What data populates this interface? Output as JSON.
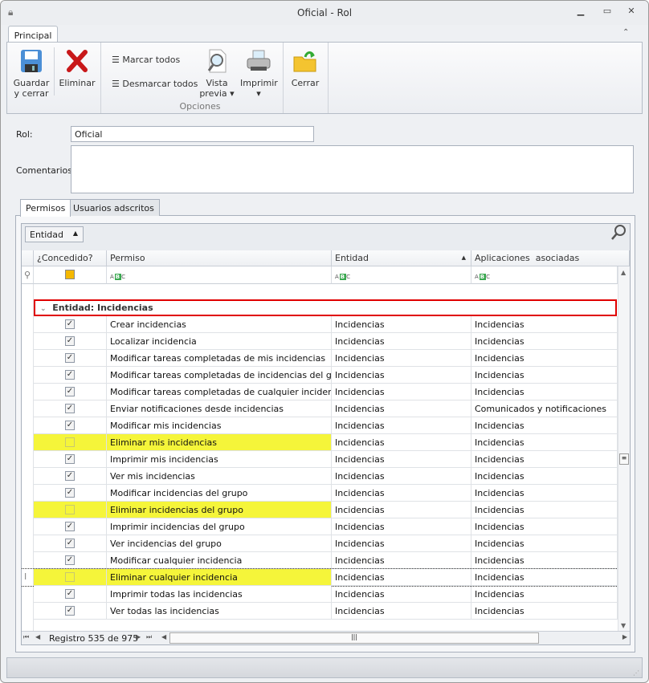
{
  "window": {
    "title": "Oficial - Rol"
  },
  "ribbon": {
    "tab": "Principal",
    "buttons": {
      "save": "Guardar\ny cerrar",
      "delete": "Eliminar",
      "check_all": "Marcar todos",
      "uncheck_all": "Desmarcar todos",
      "preview": "Vista\nprevia",
      "print": "Imprimir",
      "close": "Cerrar"
    },
    "group_label": "Opciones"
  },
  "form": {
    "rol_label": "Rol:",
    "rol_value": "Oficial",
    "comments_label": "Comentarios:",
    "comments_value": ""
  },
  "tabs": [
    "Permisos",
    "Usuarios adscritos"
  ],
  "grid": {
    "group_by_chip": "Entidad",
    "columns": [
      "¿Concedido?",
      "Permiso",
      "Entidad",
      "Aplicaciones  asociadas"
    ],
    "group_row": "Entidad: Incidencias",
    "highlight_color": "#f5f53a",
    "rows": [
      {
        "granted": true,
        "permiso": "Crear incidencias",
        "entidad": "Incidencias",
        "apps": "Incidencias"
      },
      {
        "granted": true,
        "permiso": "Localizar incidencia",
        "entidad": "Incidencias",
        "apps": "Incidencias"
      },
      {
        "granted": true,
        "permiso": "Modificar tareas completadas de mis incidencias",
        "entidad": "Incidencias",
        "apps": "Incidencias"
      },
      {
        "granted": true,
        "permiso": "Modificar tareas completadas de incidencias del grupo",
        "entidad": "Incidencias",
        "apps": "Incidencias"
      },
      {
        "granted": true,
        "permiso": "Modificar tareas completadas de cualquier incidencia",
        "entidad": "Incidencias",
        "apps": "Incidencias"
      },
      {
        "granted": true,
        "permiso": "Enviar notificaciones desde incidencias",
        "entidad": "Incidencias",
        "apps": "Comunicados y notificaciones"
      },
      {
        "granted": true,
        "permiso": "Modificar mis incidencias",
        "entidad": "Incidencias",
        "apps": "Incidencias"
      },
      {
        "granted": false,
        "permiso": "Eliminar mis incidencias",
        "entidad": "Incidencias",
        "apps": "Incidencias"
      },
      {
        "granted": true,
        "permiso": "Imprimir mis incidencias",
        "entidad": "Incidencias",
        "apps": "Incidencias"
      },
      {
        "granted": true,
        "permiso": "Ver mis incidencias",
        "entidad": "Incidencias",
        "apps": "Incidencias"
      },
      {
        "granted": true,
        "permiso": "Modificar incidencias del grupo",
        "entidad": "Incidencias",
        "apps": "Incidencias"
      },
      {
        "granted": false,
        "permiso": "Eliminar incidencias del grupo",
        "entidad": "Incidencias",
        "apps": "Incidencias"
      },
      {
        "granted": true,
        "permiso": "Imprimir incidencias del grupo",
        "entidad": "Incidencias",
        "apps": "Incidencias"
      },
      {
        "granted": true,
        "permiso": "Ver incidencias del grupo",
        "entidad": "Incidencias",
        "apps": "Incidencias"
      },
      {
        "granted": true,
        "permiso": "Modificar cualquier incidencia",
        "entidad": "Incidencias",
        "apps": "Incidencias"
      },
      {
        "granted": false,
        "permiso": "Eliminar cualquier incidencia",
        "entidad": "Incidencias",
        "apps": "Incidencias",
        "focused": true
      },
      {
        "granted": true,
        "permiso": "Imprimir todas las incidencias",
        "entidad": "Incidencias",
        "apps": "Incidencias"
      },
      {
        "granted": true,
        "permiso": "Ver todas las incidencias",
        "entidad": "Incidencias",
        "apps": "Incidencias"
      }
    ],
    "navigator": "Registro 535 de 975"
  }
}
